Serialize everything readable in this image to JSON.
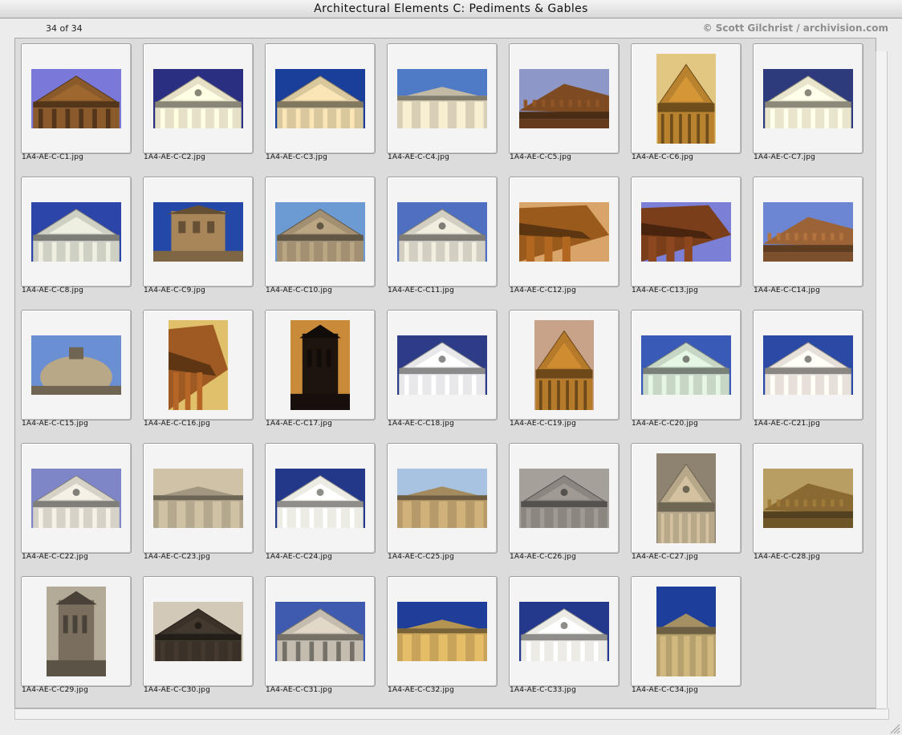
{
  "window": {
    "title": "Architectural Elements C: Pediments & Gables"
  },
  "header": {
    "counter": "34 of 34",
    "credit": "© Scott Gilchrist / archivision.com"
  },
  "colors": {
    "sky": "#3e4fb5",
    "stone": "#d8cfbd",
    "warm_stone": "#c68a3a",
    "background": "#dcdcdc"
  },
  "thumbnails": [
    {
      "name": "1A4-AE-C-C1.jpg",
      "shape": "land",
      "sky": "#7a78d8",
      "fg": "#8a5a2a",
      "kind": "temple"
    },
    {
      "name": "1A4-AE-C-C2.jpg",
      "shape": "land",
      "sky": "#2a2f82",
      "fg": "#e6e0c6",
      "kind": "pediment"
    },
    {
      "name": "1A4-AE-C-C3.jpg",
      "shape": "land",
      "sky": "#1a3f9a",
      "fg": "#d9c79e",
      "kind": "gable"
    },
    {
      "name": "1A4-AE-C-C4.jpg",
      "shape": "land",
      "sky": "#4f7ac6",
      "fg": "#d8cfb6",
      "kind": "ruin"
    },
    {
      "name": "1A4-AE-C-C5.jpg",
      "shape": "land",
      "sky": "#8d98c8",
      "fg": "#7d4a22",
      "kind": "frieze"
    },
    {
      "name": "1A4-AE-C-C6.jpg",
      "shape": "port",
      "sky": "#e1c782",
      "fg": "#b9822e",
      "kind": "temple"
    },
    {
      "name": "1A4-AE-C-C7.jpg",
      "shape": "land",
      "sky": "#2d3b7c",
      "fg": "#e9e5cd",
      "kind": "pediment"
    },
    {
      "name": "1A4-AE-C-C8.jpg",
      "shape": "land",
      "sky": "#2b45a8",
      "fg": "#cfd0c4",
      "kind": "gable"
    },
    {
      "name": "1A4-AE-C-C9.jpg",
      "shape": "land",
      "sky": "#2448a8",
      "fg": "#a8865a",
      "kind": "tower"
    },
    {
      "name": "1A4-AE-C-C10.jpg",
      "shape": "land",
      "sky": "#6b9bd2",
      "fg": "#a39072",
      "kind": "pediment"
    },
    {
      "name": "1A4-AE-C-C11.jpg",
      "shape": "land",
      "sky": "#4f6fc0",
      "fg": "#d2cec2",
      "kind": "pediment"
    },
    {
      "name": "1A4-AE-C-C12.jpg",
      "shape": "land",
      "sky": "#d9a46a",
      "fg": "#9a5a1c",
      "kind": "corner"
    },
    {
      "name": "1A4-AE-C-C13.jpg",
      "shape": "land",
      "sky": "#7b7fd6",
      "fg": "#7a3e1a",
      "kind": "corner"
    },
    {
      "name": "1A4-AE-C-C14.jpg",
      "shape": "land",
      "sky": "#6d86d4",
      "fg": "#9c6436",
      "kind": "frieze"
    },
    {
      "name": "1A4-AE-C-C15.jpg",
      "shape": "land",
      "sky": "#6a8fd2",
      "fg": "#b9a888",
      "kind": "dome"
    },
    {
      "name": "1A4-AE-C-C16.jpg",
      "shape": "port",
      "sky": "#e0c06a",
      "fg": "#9e5a22",
      "kind": "corner"
    },
    {
      "name": "1A4-AE-C-C17.jpg",
      "shape": "port",
      "sky": "#c98a3a",
      "fg": "#1e140e",
      "kind": "tower"
    },
    {
      "name": "1A4-AE-C-C18.jpg",
      "shape": "land",
      "sky": "#2c3c86",
      "fg": "#e8e8ea",
      "kind": "pediment"
    },
    {
      "name": "1A4-AE-C-C19.jpg",
      "shape": "port",
      "sky": "#c9a28a",
      "fg": "#b57a2a",
      "kind": "temple"
    },
    {
      "name": "1A4-AE-C-C20.jpg",
      "shape": "land",
      "sky": "#3a5ab8",
      "fg": "#c8d6c6",
      "kind": "pediment"
    },
    {
      "name": "1A4-AE-C-C21.jpg",
      "shape": "land",
      "sky": "#2a4aa6",
      "fg": "#e6e0d8",
      "kind": "pediment"
    },
    {
      "name": "1A4-AE-C-C22.jpg",
      "shape": "land",
      "sky": "#7f86c8",
      "fg": "#d6d2c8",
      "kind": "pediment"
    },
    {
      "name": "1A4-AE-C-C23.jpg",
      "shape": "land",
      "sky": "#cfc2a6",
      "fg": "#b4a88e",
      "kind": "ruin"
    },
    {
      "name": "1A4-AE-C-C24.jpg",
      "shape": "land",
      "sky": "#24388a",
      "fg": "#ecebe4",
      "kind": "pediment"
    },
    {
      "name": "1A4-AE-C-C25.jpg",
      "shape": "land",
      "sky": "#a8c2e2",
      "fg": "#b69a6a",
      "kind": "ruin"
    },
    {
      "name": "1A4-AE-C-C26.jpg",
      "shape": "land",
      "sky": "#a6a09a",
      "fg": "#8c8680",
      "kind": "pediment"
    },
    {
      "name": "1A4-AE-C-C27.jpg",
      "shape": "port",
      "sky": "#8e8270",
      "fg": "#b8a88a",
      "kind": "pediment"
    },
    {
      "name": "1A4-AE-C-C28.jpg",
      "shape": "land",
      "sky": "#b89e62",
      "fg": "#8a6a32",
      "kind": "frieze"
    },
    {
      "name": "1A4-AE-C-C29.jpg",
      "shape": "port",
      "sky": "#b4aa98",
      "fg": "#7a6e5e",
      "kind": "tower"
    },
    {
      "name": "1A4-AE-C-C30.jpg",
      "shape": "land",
      "sky": "#d2c9b8",
      "fg": "#3a3228",
      "kind": "pediment"
    },
    {
      "name": "1A4-AE-C-C31.jpg",
      "shape": "land",
      "sky": "#3e5bb0",
      "fg": "#c4bcae",
      "kind": "temple"
    },
    {
      "name": "1A4-AE-C-C32.jpg",
      "shape": "land",
      "sky": "#1f3e9a",
      "fg": "#c8a45a",
      "kind": "ruin"
    },
    {
      "name": "1A4-AE-C-C33.jpg",
      "shape": "land",
      "sky": "#24398c",
      "fg": "#ecebe6",
      "kind": "pediment"
    },
    {
      "name": "1A4-AE-C-C34.jpg",
      "shape": "port",
      "sky": "#1e3e9c",
      "fg": "#b6a06e",
      "kind": "ruin"
    }
  ]
}
